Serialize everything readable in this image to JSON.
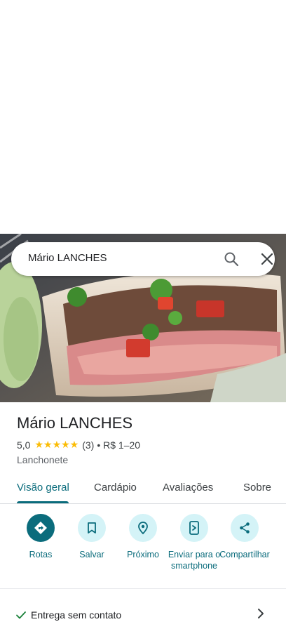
{
  "search": {
    "query": "Mário LANCHES"
  },
  "place": {
    "name": "Mário LANCHES",
    "rating": "5,0",
    "stars": "★★★★★",
    "review_count": "(3)",
    "price": "• R$ 1–20",
    "category": "Lanchonete"
  },
  "tabs": [
    {
      "label": "Visão geral",
      "active": true
    },
    {
      "label": "Cardápio"
    },
    {
      "label": "Avaliações"
    },
    {
      "label": "Sobre"
    }
  ],
  "actions": [
    {
      "label": "Rotas",
      "icon": "directions-icon"
    },
    {
      "label": "Salvar",
      "icon": "bookmark-icon"
    },
    {
      "label": "Próximo",
      "icon": "nearby-icon"
    },
    {
      "label": "Enviar para o smartphone",
      "icon": "send-to-phone-icon"
    },
    {
      "label": "Compartilhar",
      "icon": "share-icon"
    }
  ],
  "details": {
    "delivery": "Entrega sem contato"
  },
  "colors": {
    "accent": "#0b6c7c",
    "action_bg": "#d4f3f7",
    "star": "#fbbc04"
  }
}
